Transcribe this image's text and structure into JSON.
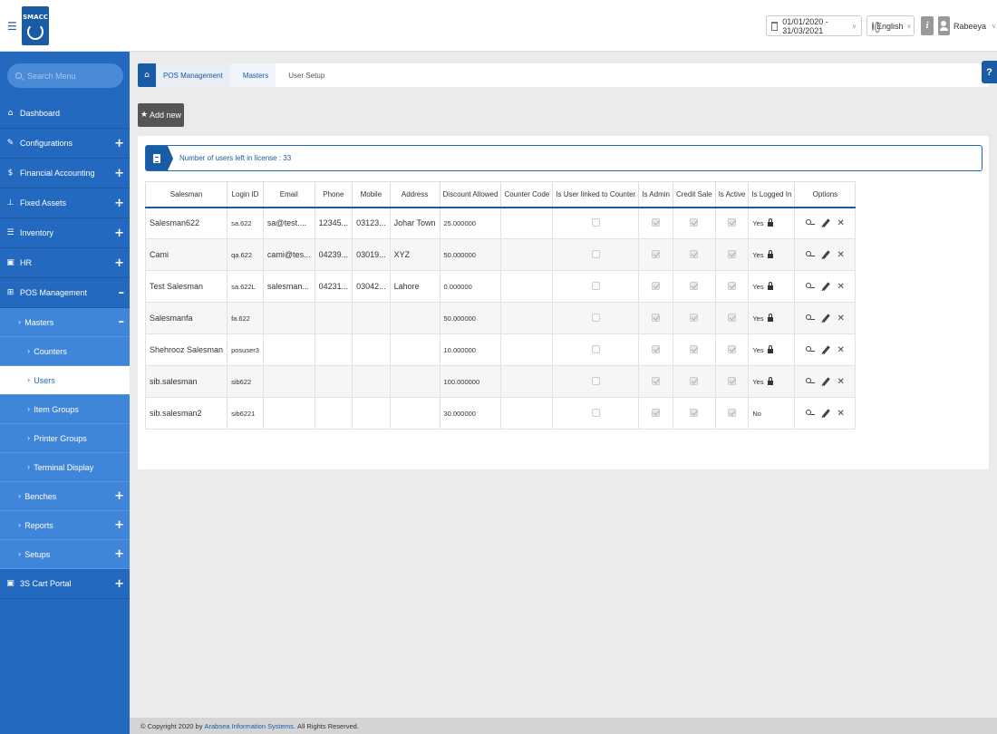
{
  "header": {
    "logo_text": "SMACC",
    "date_range": "01/01/2020 - 31/03/2021",
    "language": "English",
    "info_label": "i",
    "username": "Rabeeya"
  },
  "sidebar": {
    "search_placeholder": "Search Menu",
    "items": [
      {
        "label": "Dashboard",
        "icon": "home-icon",
        "glyph": "⌂",
        "expandable": false
      },
      {
        "label": "Configurations",
        "icon": "wrench-icon",
        "glyph": "✎",
        "expandable": true
      },
      {
        "label": "Financial Accounting",
        "icon": "dollar-icon",
        "glyph": "$",
        "expandable": true
      },
      {
        "label": "Fixed Assets",
        "icon": "pin-icon",
        "glyph": "⊥",
        "expandable": true
      },
      {
        "label": "Inventory",
        "icon": "list-icon",
        "glyph": "☰",
        "expandable": true
      },
      {
        "label": "HR",
        "icon": "id-card-icon",
        "glyph": "▣",
        "expandable": true
      },
      {
        "label": "POS Management",
        "icon": "cart-icon",
        "glyph": "⊞",
        "expanded": true
      }
    ],
    "pos_sub": {
      "masters": "Masters",
      "masters_children": [
        "Counters",
        "Users",
        "Item Groups",
        "Printer Groups",
        "Terminal Display"
      ],
      "others": [
        "Benches",
        "Reports",
        "Setups"
      ]
    },
    "last_item": {
      "label": "3S Cart Portal",
      "icon": "portal-icon",
      "glyph": "▣"
    }
  },
  "breadcrumb": [
    "POS Management",
    "Masters",
    "User Setup"
  ],
  "help_label": "?",
  "add_new_label": "Add new",
  "license_text": "Number of users left in license : 33",
  "table": {
    "headers": [
      "Salesman",
      "Login ID",
      "Email",
      "Phone",
      "Mobile",
      "Address",
      "Discount Allowed",
      "Counter Code",
      "Is User linked to Counter",
      "Is Admin",
      "Credit Sale",
      "Is Active",
      "Is Logged In",
      "Options"
    ],
    "rows": [
      {
        "salesman": "Salesman622",
        "login": "sa.622",
        "email": "sa@test....",
        "phone": "12345...",
        "mobile": "03123...",
        "address": "Johar Town",
        "discount": "25.000000",
        "counter": "",
        "logged": "Yes",
        "locked": true
      },
      {
        "salesman": "Cami",
        "login": "qa.622",
        "email": "cami@tes...",
        "phone": "04239...",
        "mobile": "03019...",
        "address": "XYZ",
        "discount": "50.000000",
        "counter": "",
        "logged": "Yes",
        "locked": true
      },
      {
        "salesman": "Test Salesman",
        "login": "sa.622L",
        "email": "salesman...",
        "phone": "04231...",
        "mobile": "03042...",
        "address": "Lahore",
        "discount": "0.000000",
        "counter": "",
        "logged": "Yes",
        "locked": true
      },
      {
        "salesman": "Salesmanfa",
        "login": "fa.622",
        "email": "",
        "phone": "",
        "mobile": "",
        "address": "",
        "discount": "50.000000",
        "counter": "",
        "logged": "Yes",
        "locked": true
      },
      {
        "salesman": "Shehrooz Salesman",
        "login": "posuser3",
        "email": "",
        "phone": "",
        "mobile": "",
        "address": "",
        "discount": "10.000000",
        "counter": "",
        "logged": "Yes",
        "locked": true
      },
      {
        "salesman": "sib.salesman",
        "login": "sib622",
        "email": "",
        "phone": "",
        "mobile": "",
        "address": "",
        "discount": "100.000000",
        "counter": "",
        "logged": "Yes",
        "locked": true
      },
      {
        "salesman": "sib.salesman2",
        "login": "sib6221",
        "email": "",
        "phone": "",
        "mobile": "",
        "address": "",
        "discount": "30.000000",
        "counter": "",
        "logged": "No",
        "locked": false
      }
    ]
  },
  "footer": {
    "prefix": "© Copyright 2020 by",
    "company": "Arabsea Information Systems.",
    "suffix": "All Rights Reserved."
  },
  "colors": {
    "brand": "#1a5ba6",
    "sidebar": "#2269bf",
    "sidebar_sub": "#3f86db"
  }
}
